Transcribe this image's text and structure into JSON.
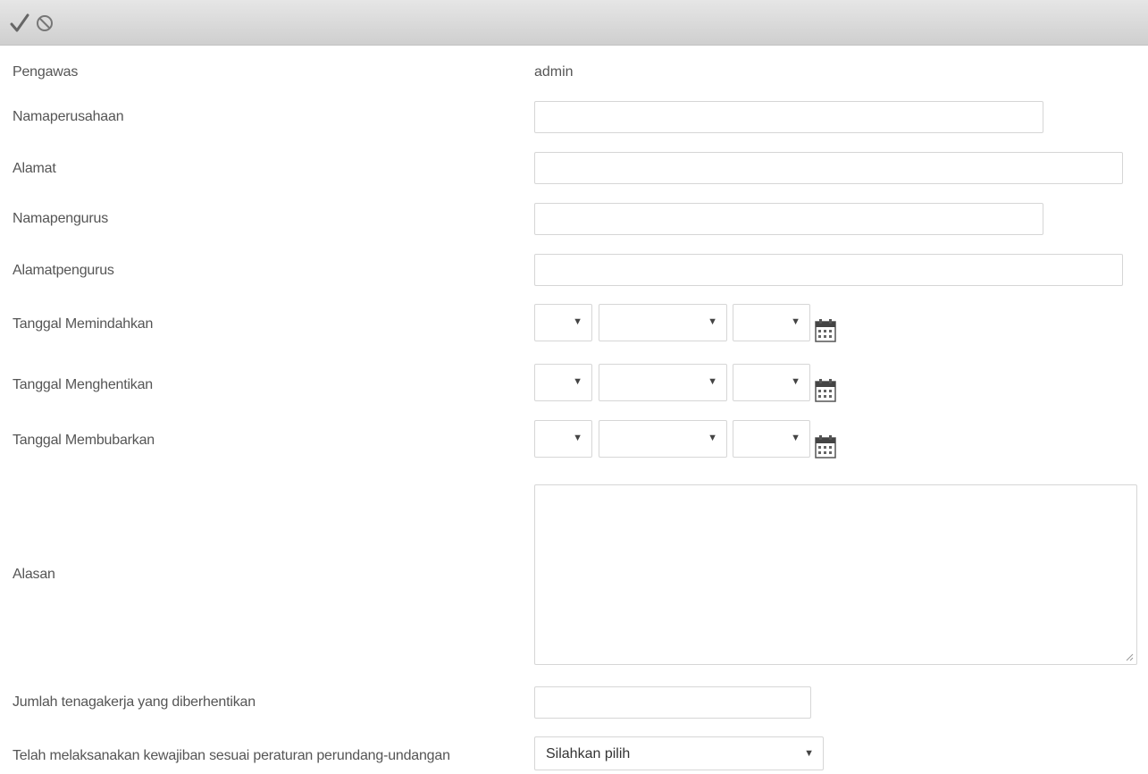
{
  "toolbar": {
    "save_icon": "checkmark-icon",
    "cancel_icon": "cancel-icon"
  },
  "form": {
    "pengawas": {
      "label": "Pengawas",
      "value": "admin"
    },
    "namaperusahaan": {
      "label": "Namaperusahaan",
      "value": ""
    },
    "alamat": {
      "label": "Alamat",
      "value": ""
    },
    "namapengurus": {
      "label": "Namapengurus",
      "value": ""
    },
    "alamatpengurus": {
      "label": "Alamatpengurus",
      "value": ""
    },
    "tanggal_memindahkan": {
      "label": "Tanggal Memindahkan",
      "day": "",
      "month": "",
      "year": "",
      "icon": "calendar-icon"
    },
    "tanggal_menghentikan": {
      "label": "Tanggal Menghentikan",
      "day": "",
      "month": "",
      "year": "",
      "icon": "calendar-icon"
    },
    "tanggal_membubarkan": {
      "label": "Tanggal Membubarkan",
      "day": "",
      "month": "",
      "year": "",
      "icon": "calendar-icon"
    },
    "alasan": {
      "label": "Alasan",
      "value": ""
    },
    "jumlah_tenagakerja": {
      "label": "Jumlah tenagakerja yang diberhentikan",
      "value": ""
    },
    "kewajiban": {
      "label": "Telah melaksanakan kewajiban sesuai peraturan perundang-undangan",
      "selected": "Silahkan pilih"
    }
  },
  "colors": {
    "toolbar_bg": "#d9d9d9",
    "border": "#d6d6d6",
    "text": "#555555"
  }
}
